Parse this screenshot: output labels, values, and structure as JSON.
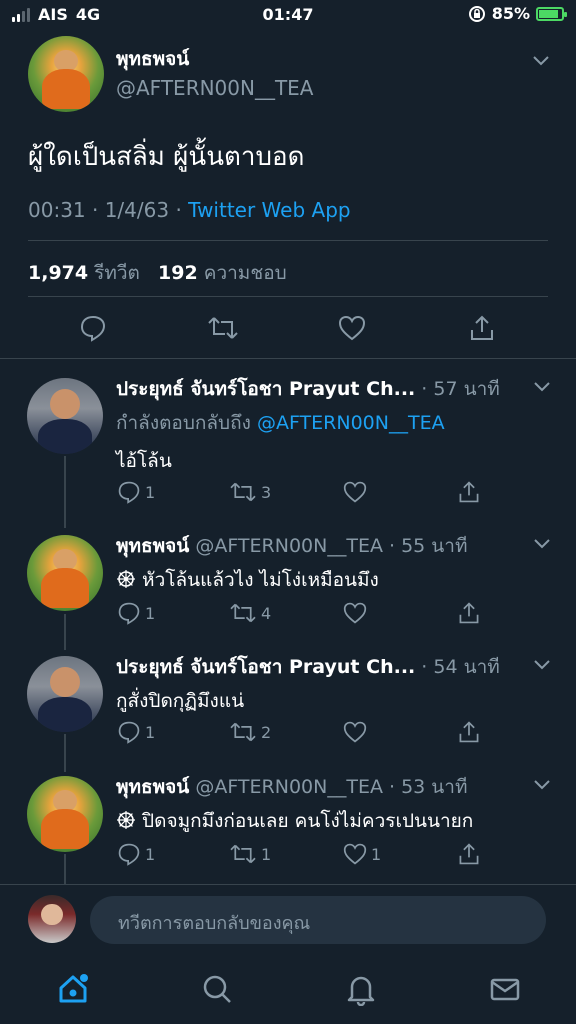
{
  "status_bar": {
    "carrier": "AIS",
    "network": "4G",
    "time": "01:47",
    "battery": "85%",
    "battery_level": 0.85
  },
  "main_tweet": {
    "display_name": "พุทธพจน์",
    "handle": "@AFTERN00N__TEA",
    "text": "ผู้ใดเป็นสลิ่ม ผู้นั้นตาบอด",
    "time": "00:31 · 1/4/63 ·",
    "source": "Twitter Web App",
    "retweets_count": "1,974",
    "retweets_label": "รีทวีต",
    "likes_count": "192",
    "likes_label": "ความชอบ"
  },
  "replies": [
    {
      "display_name": "ประยุทธ์ จันทร์โอชา Prayut Ch...",
      "handle": "",
      "time": "· 57 นาที",
      "replying_label": "กำลังตอบกลับถึง",
      "replying_to": "@AFTERN00N__TEA",
      "text": "ไอ้โล้น",
      "replies": "1",
      "retweets": "3",
      "likes": ""
    },
    {
      "display_name": "พุทธพจน์",
      "handle": "@AFTERN00N__TEA",
      "time": "· 55 นาที",
      "text": "หัวโล้นแล้วไง ไม่โง่เหมือนมึง",
      "replies": "1",
      "retweets": "4",
      "likes": ""
    },
    {
      "display_name": "ประยุทธ์ จันทร์โอชา Prayut Ch...",
      "handle": "",
      "time": "· 54 นาที",
      "text": "กูสั่งปิดกุฏิมึงแน่",
      "replies": "1",
      "retweets": "2",
      "likes": ""
    },
    {
      "display_name": "พุทธพจน์",
      "handle": "@AFTERN00N__TEA",
      "time": "· 53 นาที",
      "text": "ปิดจมูกมึงก่อนเลย คนโง่ไม่ควรเปนนายก",
      "replies": "1",
      "retweets": "1",
      "likes": "1"
    }
  ],
  "compose": {
    "placeholder": "ทวีตการตอบกลับของคุณ"
  },
  "tabbar": {
    "items": [
      "home-icon",
      "search-icon",
      "bell-icon",
      "mail-icon"
    ],
    "active": "home-icon"
  },
  "colors": {
    "background": "#15202b",
    "accent": "#1da1f2",
    "muted": "#8899a6",
    "divider": "#38444d",
    "battery": "#4cd964"
  }
}
